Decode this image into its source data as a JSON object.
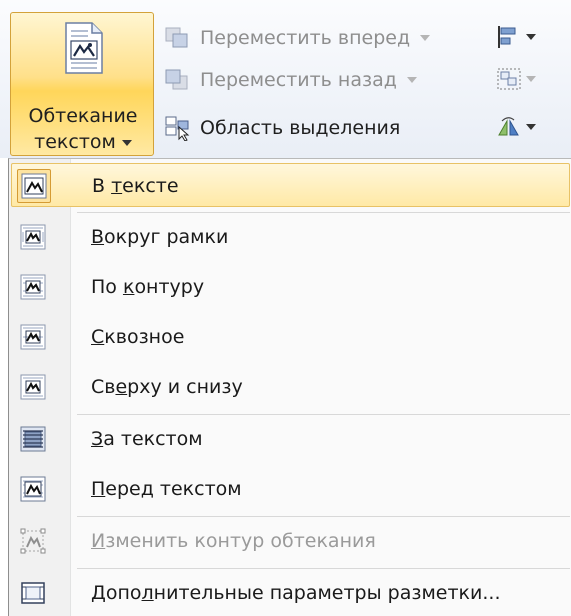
{
  "ribbon": {
    "wrap_button": {
      "label_line1": "Обтекание",
      "label_line2": "текстом",
      "icon": "text-wrap-icon"
    },
    "rows": [
      {
        "label": "Переместить вперед",
        "icon": "bring-forward-icon",
        "disabled": true,
        "has_dropdown": true
      },
      {
        "label": "Переместить назад",
        "icon": "send-backward-icon",
        "disabled": true,
        "has_dropdown": true
      },
      {
        "label": "Область выделения",
        "icon": "selection-pane-icon",
        "disabled": false,
        "has_dropdown": false
      }
    ],
    "right_icons": [
      "align-icon",
      "group-icon",
      "rotate-icon"
    ]
  },
  "menu": {
    "items": [
      {
        "pre": "В ",
        "mn": "т",
        "post": "ексте",
        "icon": "wrap-inline-icon",
        "highlighted": true,
        "disabled": false
      },
      {
        "pre": "",
        "mn": "В",
        "post": "округ рамки",
        "icon": "wrap-square-icon",
        "highlighted": false,
        "disabled": false
      },
      {
        "pre": "По ",
        "mn": "к",
        "post": "онтуру",
        "icon": "wrap-tight-icon",
        "highlighted": false,
        "disabled": false
      },
      {
        "pre": "",
        "mn": "С",
        "post": "квозное",
        "icon": "wrap-through-icon",
        "highlighted": false,
        "disabled": false
      },
      {
        "pre": "Св",
        "mn": "е",
        "post": "рху и снизу",
        "icon": "wrap-top-bottom-icon",
        "highlighted": false,
        "disabled": false
      },
      {
        "pre": "",
        "mn": "З",
        "post": "а текстом",
        "icon": "behind-text-icon",
        "highlighted": false,
        "disabled": false
      },
      {
        "pre": "",
        "mn": "П",
        "post": "еред текстом",
        "icon": "in-front-of-text-icon",
        "highlighted": false,
        "disabled": false
      },
      {
        "pre": "",
        "mn": "И",
        "post": "зменить контур обтекания",
        "icon": "edit-wrap-points-icon",
        "highlighted": false,
        "disabled": true
      },
      {
        "pre": "Допо",
        "mn": "л",
        "post": "нительные параметры разметки...",
        "icon": "more-layout-options-icon",
        "highlighted": false,
        "disabled": false
      }
    ]
  }
}
